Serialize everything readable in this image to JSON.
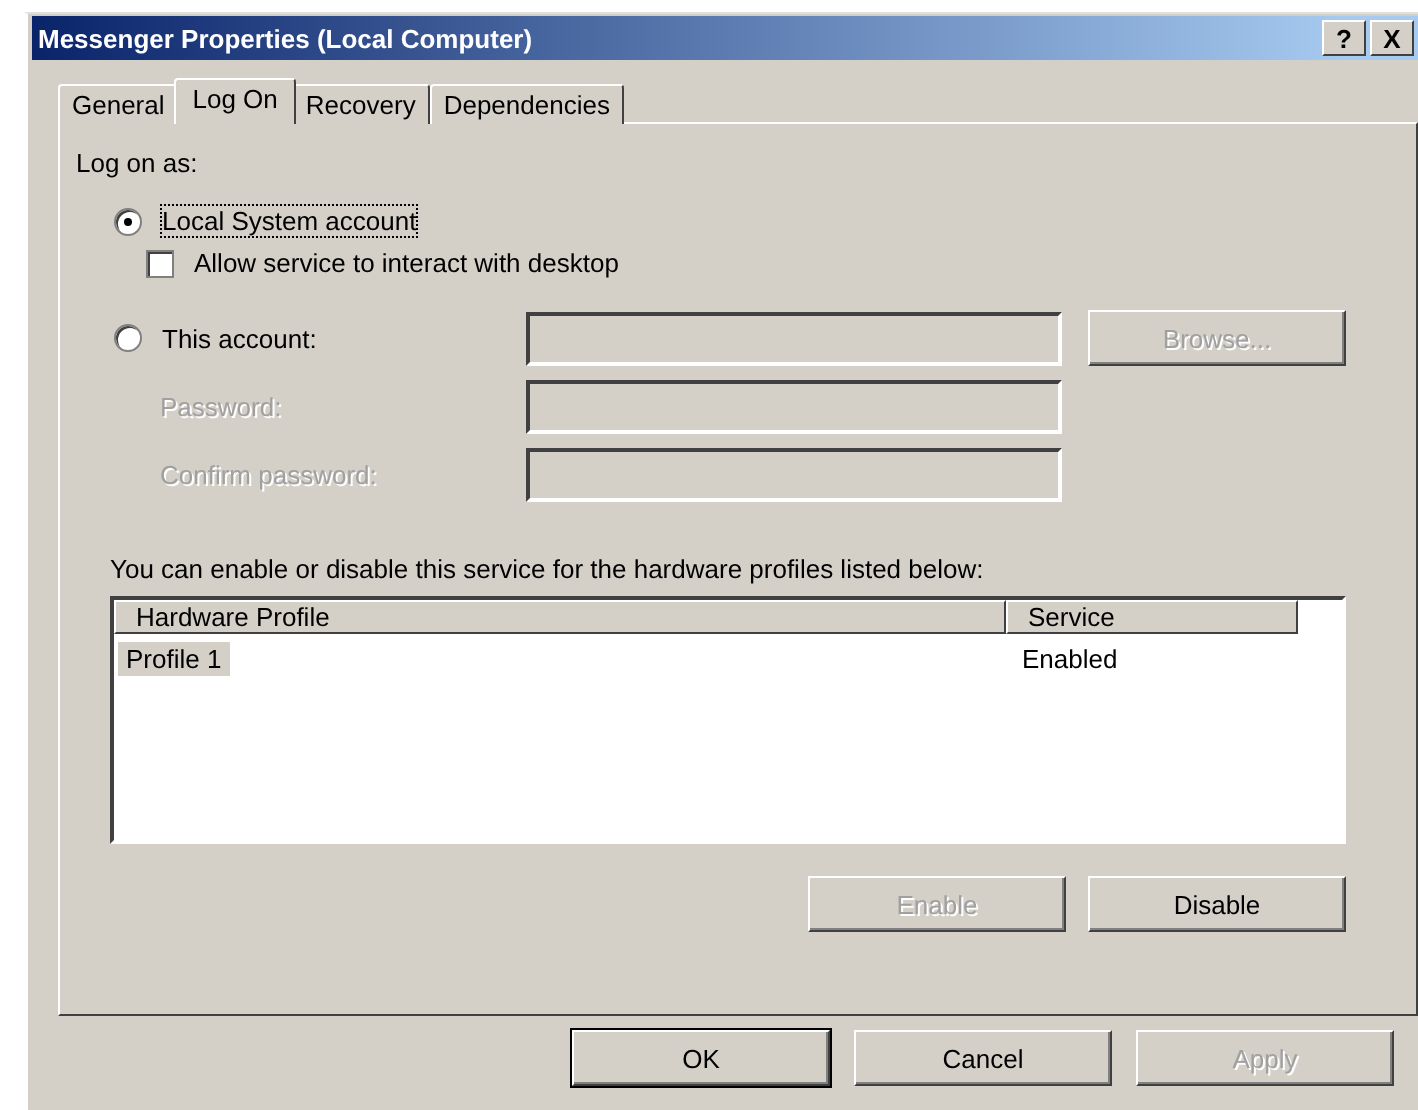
{
  "window": {
    "title": "Messenger Properties (Local Computer)",
    "controls": [
      "?",
      "X"
    ]
  },
  "tabs": [
    {
      "label": "General",
      "selected": false
    },
    {
      "label": "Log On",
      "selected": true
    },
    {
      "label": "Recovery",
      "selected": false
    },
    {
      "label": "Dependencies",
      "selected": false
    }
  ],
  "log_on_as": {
    "label": "Log on as:",
    "options": [
      {
        "label": "Local System account",
        "selected": true
      },
      {
        "label": "This account:",
        "selected": false
      }
    ],
    "interact_checkbox": {
      "label": "Allow service to interact with desktop",
      "checked": false
    }
  },
  "account_field": {
    "disabled": true
  },
  "browse_button": {
    "label": "Browse...",
    "disabled": true
  },
  "password_fields": [
    {
      "label": "Password:",
      "disabled": true
    },
    {
      "label": "Confirm password:",
      "disabled": true
    }
  ],
  "hardware_profiles": {
    "label": "You can enable or disable this service for the hardware profiles listed below:",
    "columns": [
      "Hardware Profile",
      "Service"
    ],
    "rows": [
      {
        "cells": [
          "Profile 1",
          "Enabled"
        ],
        "selected": true
      }
    ]
  },
  "profile_buttons": [
    {
      "label": "Enable",
      "disabled": true
    },
    {
      "label": "Disable",
      "disabled": false
    }
  ],
  "dialog_buttons": [
    {
      "label": "OK",
      "disabled": false,
      "default": true
    },
    {
      "label": "Cancel",
      "disabled": false,
      "default": false
    },
    {
      "label": "Apply",
      "disabled": true,
      "default": false
    }
  ]
}
